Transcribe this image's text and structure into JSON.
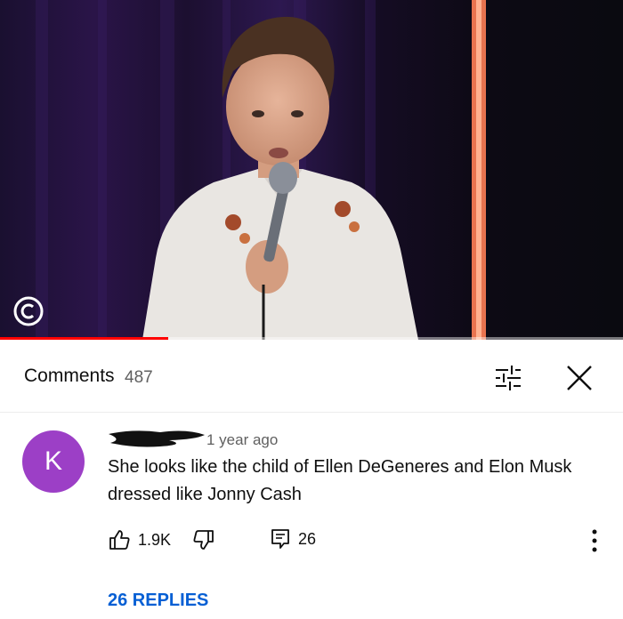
{
  "video": {
    "channel_logo_icon": "comedy-central-logo",
    "progress_fraction": 0.27
  },
  "comments_header": {
    "title": "Comments",
    "count": "487"
  },
  "comment": {
    "avatar_letter": "K",
    "avatar_color": "#9c3fc6",
    "time": "1 year ago",
    "text": "She looks like the child of Ellen DeGeneres and Elon Musk dressed like Jonny Cash",
    "likes": "1.9K",
    "reply_count": "26",
    "replies_link": "26 REPLIES"
  },
  "colors": {
    "link_blue": "#065fd4",
    "progress_red": "#ff0000"
  }
}
